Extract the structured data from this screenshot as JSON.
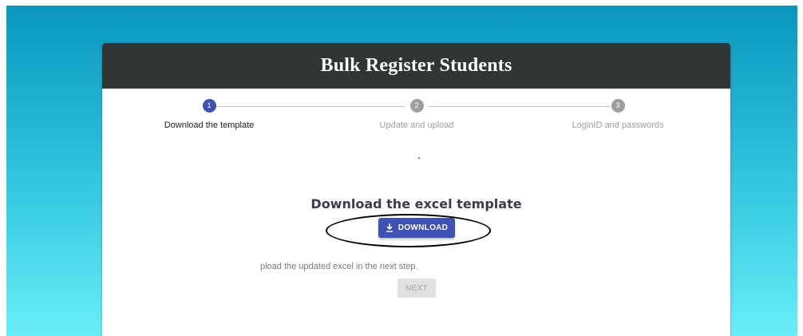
{
  "card": {
    "title": "Bulk Register Students"
  },
  "stepper": {
    "steps": [
      {
        "number": "1",
        "label": "Download the template",
        "active": true
      },
      {
        "number": "2",
        "label": "Update and upload",
        "active": false
      },
      {
        "number": "3",
        "label": "LoginID and passwords",
        "active": false
      }
    ]
  },
  "main": {
    "heading": "Download the excel template",
    "download_label": "DOWNLOAD",
    "download_icon": "download-icon",
    "instruction": "pload the updated excel in the next step.",
    "next_label": "NEXT"
  },
  "colors": {
    "header_bg": "#303633",
    "primary": "#3f51b5",
    "step_inactive": "#9e9e9e",
    "background_top": "#0a96bd",
    "background_bottom": "#68eef8"
  }
}
